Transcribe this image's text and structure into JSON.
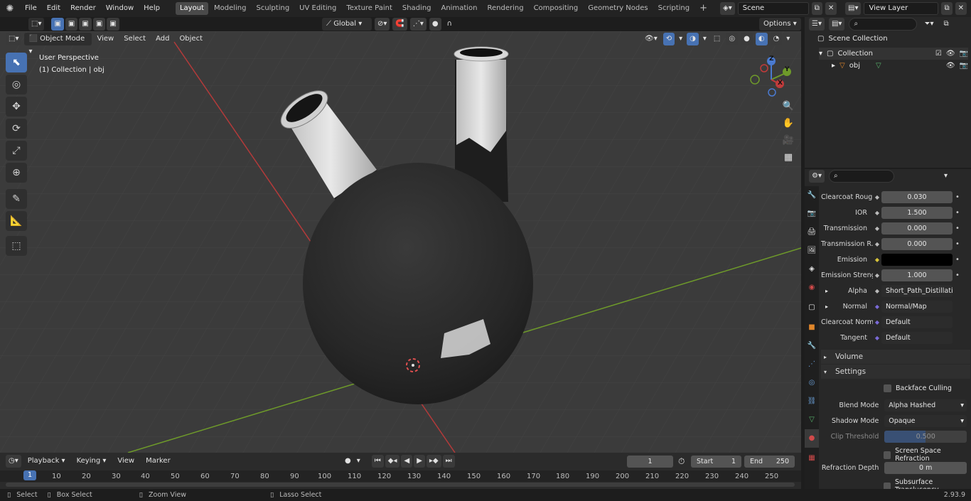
{
  "menu": {
    "items": [
      "File",
      "Edit",
      "Render",
      "Window",
      "Help"
    ]
  },
  "workspaces": [
    "Layout",
    "Modeling",
    "Sculpting",
    "UV Editing",
    "Texture Paint",
    "Shading",
    "Animation",
    "Rendering",
    "Compositing",
    "Geometry Nodes",
    "Scripting"
  ],
  "active_workspace": "Layout",
  "scene": {
    "name": "Scene",
    "view_layer": "View Layer"
  },
  "viewport": {
    "mode": "Object Mode",
    "menus": [
      "View",
      "Select",
      "Add",
      "Object"
    ],
    "orientation": "Global",
    "options_label": "Options",
    "overlay_title": "User Perspective",
    "overlay_subtitle": "(1) Collection | obj",
    "gizmo_axes": {
      "x": "X",
      "y": "Y",
      "z": "Z"
    }
  },
  "outliner": {
    "root": "Scene Collection",
    "collection": "Collection",
    "object": "obj"
  },
  "properties": {
    "rows": [
      {
        "label": "Clearcoat Roug...",
        "value": "0.030",
        "type": "num"
      },
      {
        "label": "IOR",
        "value": "1.500",
        "type": "num"
      },
      {
        "label": "Transmission",
        "value": "0.000",
        "type": "num"
      },
      {
        "label": "Transmission R...",
        "value": "0.000",
        "type": "num"
      },
      {
        "label": "Emission",
        "value": "",
        "type": "color"
      },
      {
        "label": "Emission Strengt",
        "value": "1.000",
        "type": "num"
      },
      {
        "label": "Alpha",
        "value": "Short_Path_Distillati...",
        "type": "link"
      },
      {
        "label": "Normal",
        "value": "Normal/Map",
        "type": "link"
      },
      {
        "label": "Clearcoat Normal",
        "value": "Default",
        "type": "link"
      },
      {
        "label": "Tangent",
        "value": "Default",
        "type": "link"
      }
    ],
    "volume_section": "Volume",
    "settings_section": "Settings",
    "backface_culling": "Backface Culling",
    "blend_mode_label": "Blend Mode",
    "blend_mode_value": "Alpha Hashed",
    "shadow_mode_label": "Shadow Mode",
    "shadow_mode_value": "Opaque",
    "clip_threshold_label": "Clip Threshold",
    "clip_threshold_value": "0.500",
    "screen_space_refraction": "Screen Space Refraction",
    "refraction_depth_label": "Refraction Depth",
    "refraction_depth_value": "0 m",
    "subsurface_translucency": "Subsurface Translucency"
  },
  "timeline": {
    "menus": [
      "Playback",
      "Keying",
      "View",
      "Marker"
    ],
    "current_frame": "1",
    "start_label": "Start",
    "start_value": "1",
    "end_label": "End",
    "end_value": "250",
    "ruler": [
      "1",
      "10",
      "20",
      "30",
      "40",
      "50",
      "60",
      "70",
      "80",
      "90",
      "100",
      "110",
      "120",
      "130",
      "140",
      "150",
      "160",
      "170",
      "180",
      "190",
      "200",
      "210",
      "220",
      "230",
      "240",
      "250"
    ]
  },
  "statusbar": {
    "select": "Select",
    "box_select": "Box Select",
    "zoom_view": "Zoom View",
    "lasso_select": "Lasso Select",
    "version": "2.93.9"
  },
  "colors": {
    "accent": "#4772b3",
    "viewport_bg": "#3b3b3b",
    "x_axis": "#c03b3b",
    "y_axis": "#6f9c2b"
  }
}
